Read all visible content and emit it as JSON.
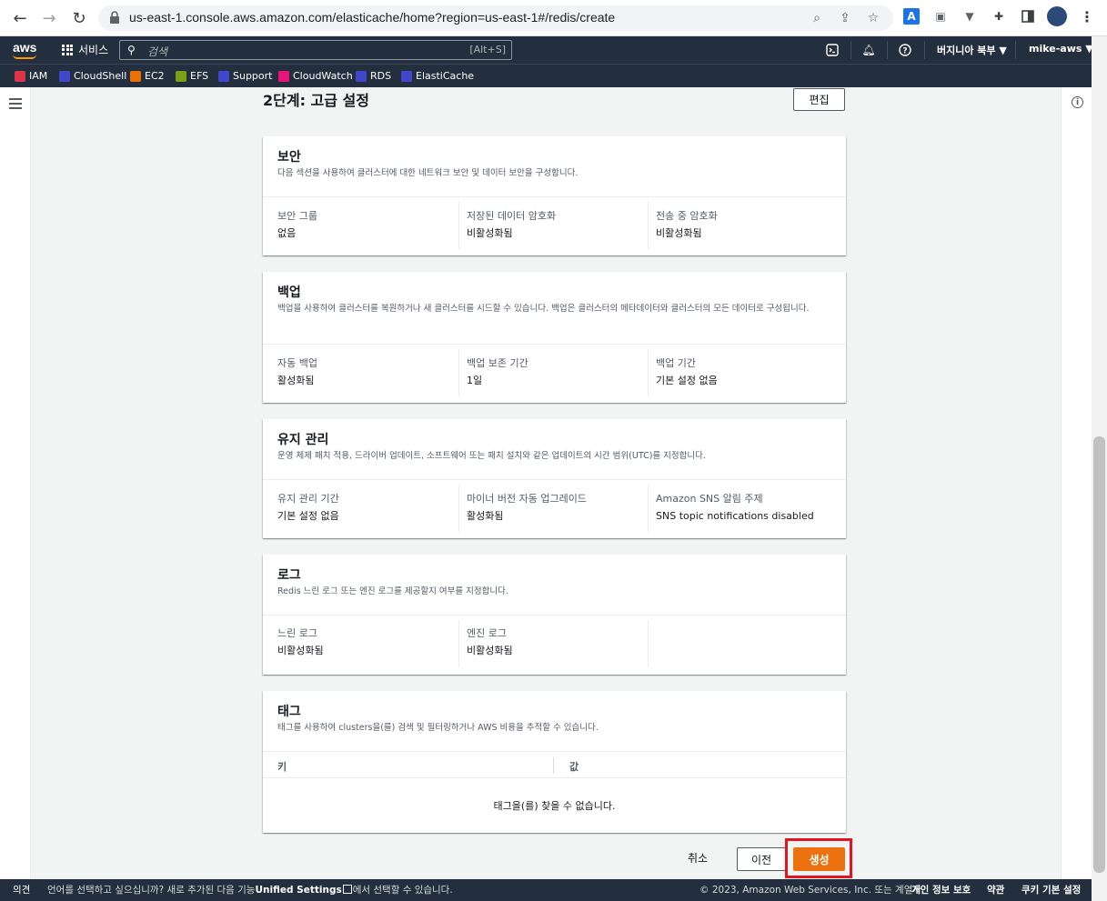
{
  "browser": {
    "url": "us-east-1.console.aws.amazon.com/elasticache/home?region=us-east-1#/redis/create"
  },
  "aws_header": {
    "logo": "aws",
    "services_label": "서비스",
    "search_placeholder": "검색",
    "search_shortcut": "[Alt+S]",
    "region": "버지니아 북부 ▼",
    "account": "mike-aws ▼"
  },
  "favorites": [
    {
      "label": "IAM",
      "color": "#dd344c"
    },
    {
      "label": "CloudShell",
      "color": "#3f48cc"
    },
    {
      "label": "EC2",
      "color": "#ed7100"
    },
    {
      "label": "EFS",
      "color": "#7aa116"
    },
    {
      "label": "Support",
      "color": "#3f48cc"
    },
    {
      "label": "CloudWatch",
      "color": "#e7157b"
    },
    {
      "label": "RDS",
      "color": "#3f48cc"
    },
    {
      "label": "ElastiCache",
      "color": "#3f48cc"
    }
  ],
  "page": {
    "step_title": "2단계: 고급 설정",
    "edit_button": "편집"
  },
  "security": {
    "title": "보안",
    "description": "다음 섹션을 사용하여 클러스터에 대한 네트워크 보안 및 데이터 보안을 구성합니다.",
    "items": [
      {
        "key": "보안 그룹",
        "value": "없음"
      },
      {
        "key": "저장된 데이터 암호화",
        "value": "비활성화됨"
      },
      {
        "key": "전송 중 암호화",
        "value": "비활성화됨"
      }
    ]
  },
  "backup": {
    "title": "백업",
    "description": "백업을 사용하여 클러스터를 복원하거나 새 클러스터를 시드할 수 있습니다. 백업은 클러스터의 메타데이터와 클러스터의 모든 데이터로 구성됩니다.",
    "items": [
      {
        "key": "자동 백업",
        "value": "활성화됨"
      },
      {
        "key": "백업 보존 기간",
        "value": "1일"
      },
      {
        "key": "백업 기간",
        "value": "기본 설정 없음"
      }
    ]
  },
  "maintenance": {
    "title": "유지 관리",
    "description": "운영 체제 패치 적용, 드라이버 업데이트, 소프트웨어 또는 패치 설치와 같은 업데이트의 시간 범위(UTC)를 지정합니다.",
    "items": [
      {
        "key": "유지 관리 기간",
        "value": "기본 설정 없음"
      },
      {
        "key": "마이너 버전 자동 업그레이드",
        "value": "활성화됨"
      },
      {
        "key": "Amazon SNS 알림 주제",
        "value": "SNS topic notifications disabled"
      }
    ]
  },
  "logs": {
    "title": "로그",
    "description": "Redis 느린 로그 또는 엔진 로그를 제공할지 여부를 지정합니다.",
    "items": [
      {
        "key": "느린 로그",
        "value": "비활성화됨"
      },
      {
        "key": "엔진 로그",
        "value": "비활성화됨"
      }
    ]
  },
  "tags": {
    "title": "태그",
    "description": "태그를 사용하여 clusters을(를) 검색 및 필터링하거나 AWS 비용을 추적할 수 있습니다.",
    "col_key": "키",
    "col_value": "값",
    "empty": "태그을(를) 찾을 수 없습니다."
  },
  "actions": {
    "cancel": "취소",
    "previous": "이전",
    "create": "생성"
  },
  "footer": {
    "feedback": "의견",
    "language_text_1": "언어를 선택하고 싶으십니까? 새로 추가된 다음 기능",
    "unified_settings": "Unified Settings",
    "language_text_2": "에서 선택할 수 있습니다.",
    "copyright": "© 2023, Amazon Web Services, Inc. 또는 계열사.",
    "privacy": "개인 정보 보호",
    "terms": "약관",
    "cookies": "쿠키 기본 설정"
  }
}
